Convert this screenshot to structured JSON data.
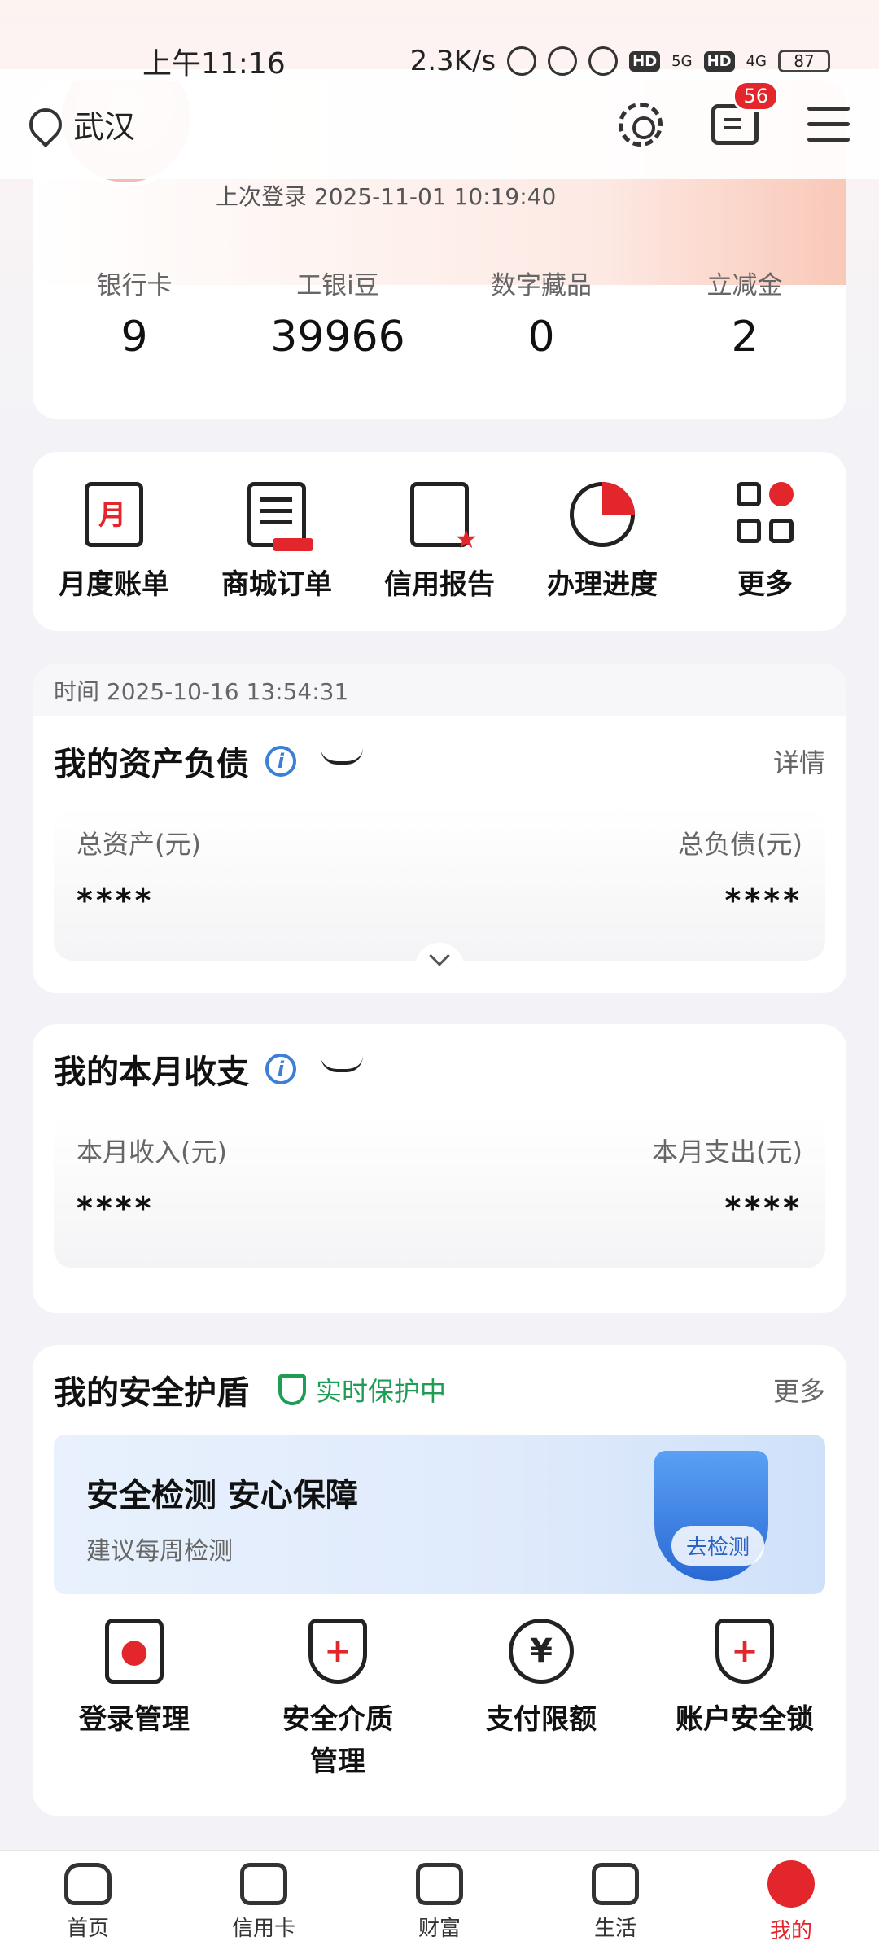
{
  "status_bar": {
    "time": "上午11:16",
    "speed": "2.3K/s",
    "net1": "5G",
    "net2": "4G",
    "battery": "87"
  },
  "header": {
    "location": "武汉",
    "message_badge": "56"
  },
  "profile": {
    "last_login": "上次登录 2025-11-01 10:19:40",
    "stats": [
      {
        "label": "银行卡",
        "value": "9"
      },
      {
        "label": "工银i豆",
        "value": "39966"
      },
      {
        "label": "数字藏品",
        "value": "0"
      },
      {
        "label": "立减金",
        "value": "2"
      }
    ]
  },
  "quick_menu": [
    {
      "label": "月度账单"
    },
    {
      "label": "商城订单"
    },
    {
      "label": "信用报告"
    },
    {
      "label": "办理进度"
    },
    {
      "label": "更多"
    }
  ],
  "assets": {
    "time": "时间 2025-10-16 13:54:31",
    "title": "我的资产负债",
    "detail_link": "详情",
    "total_assets_label": "总资产(元)",
    "total_assets_value": "****",
    "total_liabilities_label": "总负债(元)",
    "total_liabilities_value": "****"
  },
  "income": {
    "title": "我的本月收支",
    "income_label": "本月收入(元)",
    "income_value": "****",
    "expense_label": "本月支出(元)",
    "expense_value": "****"
  },
  "security": {
    "title": "我的安全护盾",
    "status": "实时保护中",
    "more_link": "更多",
    "banner_title": "安全检测 安心保障",
    "banner_sub": "建议每周检测",
    "banner_button": "去检测",
    "items": [
      {
        "label": "登录管理"
      },
      {
        "label": "安全介质管理"
      },
      {
        "label": "支付限额"
      },
      {
        "label": "账户安全锁"
      }
    ]
  },
  "bottom_nav": [
    {
      "label": "首页"
    },
    {
      "label": "信用卡"
    },
    {
      "label": "财富"
    },
    {
      "label": "生活"
    },
    {
      "label": "我的"
    }
  ]
}
